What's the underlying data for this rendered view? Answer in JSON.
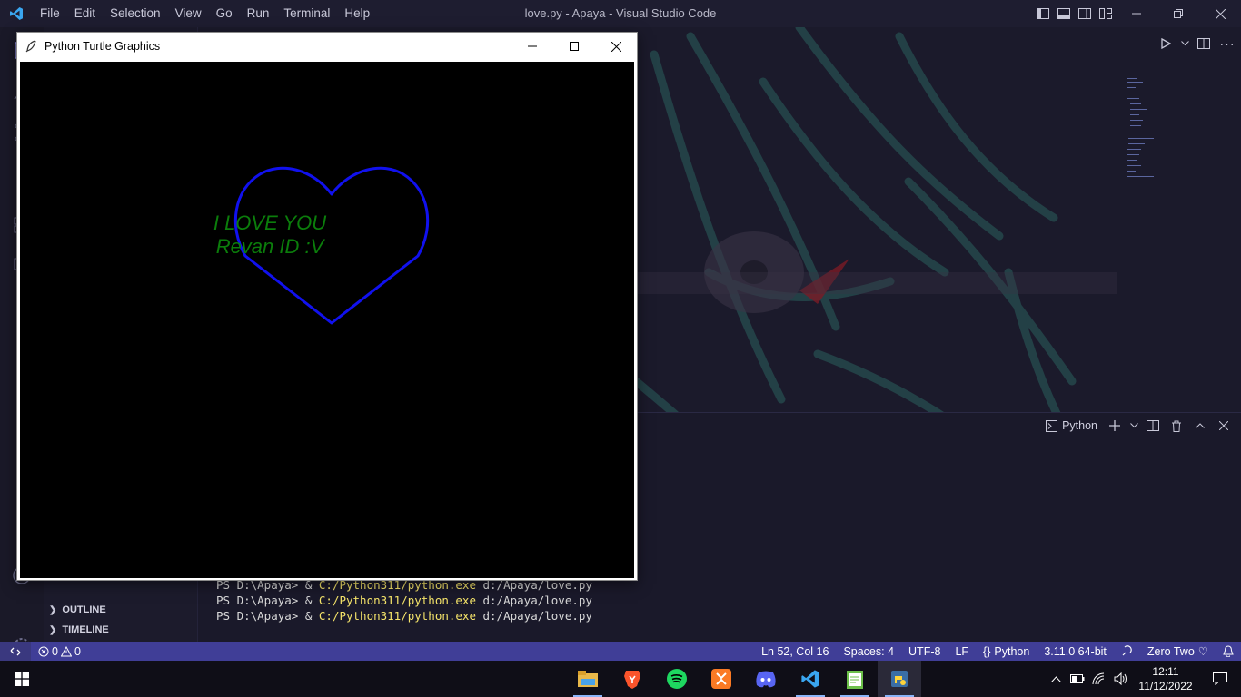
{
  "app": {
    "window_title": "love.py - Apaya - Visual Studio Code",
    "menu": [
      "File",
      "Edit",
      "Selection",
      "View",
      "Go",
      "Run",
      "Terminal",
      "Help"
    ]
  },
  "sidebar": {
    "outline_label": "OUTLINE",
    "timeline_label": "TIMELINE",
    "settings_badge": "1"
  },
  "panel": {
    "terminal_name": "Python",
    "lines": [
      {
        "prompt": "PS D:\\Apaya> & ",
        "exe": "C:/Python311/python.exe",
        "arg": " d:/Apaya/love.py"
      },
      {
        "prompt": "PS D:\\Apaya> & ",
        "exe": "C:/Python311/python.exe",
        "arg": " d:/Apaya/love.py"
      },
      {
        "prompt": "PS D:\\Apaya> & ",
        "exe": "C:/Python311/python.exe",
        "arg": " d:/Apaya/love.py"
      }
    ]
  },
  "statusbar": {
    "errors": "0",
    "warnings": "0",
    "position": "Ln 52, Col 16",
    "spaces": "Spaces: 4",
    "encoding": "UTF-8",
    "eol": "LF",
    "language": "Python",
    "interpreter": "3.11.0 64-bit",
    "theme": "Zero Two"
  },
  "turtle": {
    "window_title": "Python Turtle Graphics",
    "line1": "I LOVE YOU",
    "line2": "Revan ID :V",
    "heart_color": "#1111ee",
    "text_color": "#0b7d0b"
  },
  "taskbar": {
    "apps": [
      "file-explorer",
      "brave",
      "spotify",
      "xampp",
      "discord",
      "vscode",
      "notepad",
      "python"
    ],
    "time": "12:11",
    "date": "11/12/2022"
  },
  "colors": {
    "statusbar": "#403e97",
    "accent": "#5a57c8"
  }
}
